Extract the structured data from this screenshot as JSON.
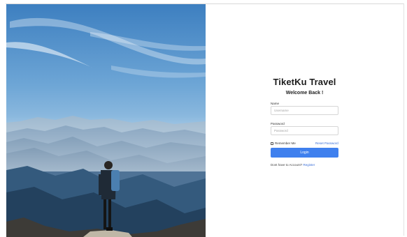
{
  "app": {
    "brand_title": "TiketKu Travel",
    "welcome": "Welcome Back !"
  },
  "form": {
    "name_label": "Name",
    "name_placeholder": "Username",
    "password_label": "Password",
    "password_placeholder": "Password",
    "remember_label": "Remember Me",
    "reset_link": "Reset Password",
    "login_button": "Login",
    "register_prompt": "Dont have to Account?",
    "register_link": "Register"
  },
  "colors": {
    "primary": "#3f80ee",
    "link": "#3a6fd8"
  },
  "icons": {
    "remember_checkbox": "checkbox-icon"
  }
}
